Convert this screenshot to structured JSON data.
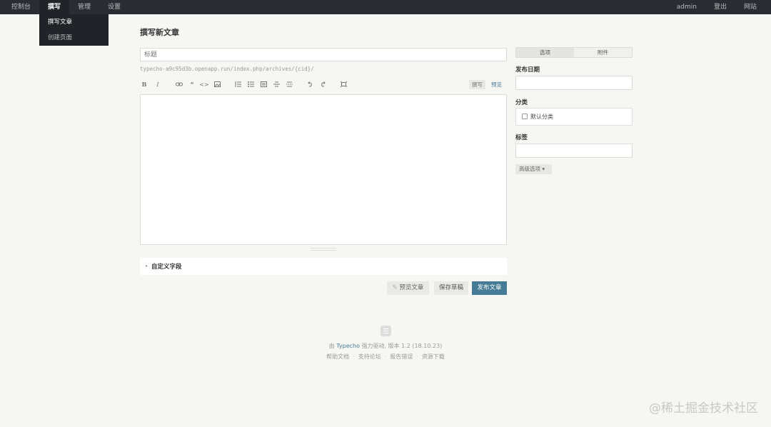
{
  "nav": {
    "left": [
      "控制台",
      "撰写",
      "管理",
      "设置"
    ],
    "active_index": 1,
    "right": [
      "admin",
      "登出",
      "网站"
    ]
  },
  "dropdown": [
    "撰写文章",
    "创建页面"
  ],
  "page_title": "撰写新文章",
  "editor": {
    "title_placeholder": "标题",
    "permalink": "typecho-a9c95d3b.openapp.run/index.php/archives/{cid}/",
    "toolbar_icons": [
      "bold-icon",
      "italic-icon",
      "link-icon",
      "quote-icon",
      "code-icon",
      "image-icon",
      "ordered-list-icon",
      "unordered-list-icon",
      "heading-icon",
      "hr-icon",
      "more-icon",
      "undo-icon",
      "redo-icon",
      "fullscreen-icon"
    ],
    "mode_write": "撰写",
    "mode_preview": "预览",
    "body": ""
  },
  "custom_fields": {
    "arrow": "▸",
    "label": "自定义字段"
  },
  "actions": {
    "preview": "预览文章",
    "draft": "保存草稿",
    "publish": "发布文章"
  },
  "sidebar": {
    "tabs": [
      "选项",
      "附件"
    ],
    "date_label": "发布日期",
    "category_label": "分类",
    "category_default": "默认分类",
    "tags_label": "标签",
    "advanced": "高级选项 ▾"
  },
  "footer": {
    "prefix": "由",
    "brand": "Typecho",
    "suffix": "强力驱动, 版本 1.2 (18.10.23)",
    "links": [
      "帮助文档",
      "支持论坛",
      "报告错误",
      "资源下载"
    ],
    "separator": "·"
  },
  "watermark": "@稀土掘金技术社区",
  "colors": {
    "accent": "#467b96",
    "topbar": "#292d33",
    "background": "#f6f6f3"
  }
}
